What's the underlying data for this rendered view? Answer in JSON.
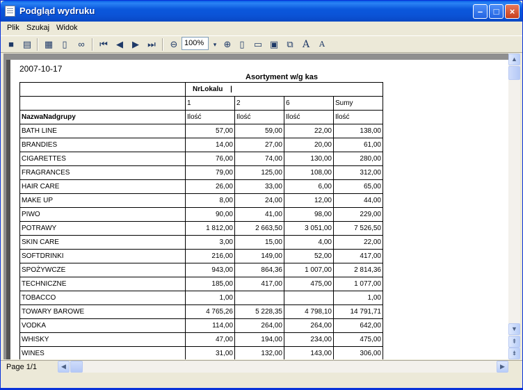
{
  "window": {
    "title": "Podgląd wydruku"
  },
  "menu": [
    "Plik",
    "Szukaj",
    "Widok"
  ],
  "toolbar": {
    "zoom_value": "100%",
    "zoom_arrow": "▾"
  },
  "icons": [
    "save-icon",
    "print-icon",
    "page-setup-icon",
    "page-icon",
    "find-icon",
    "first-page-icon",
    "prev-page-icon",
    "next-page-icon",
    "last-page-icon",
    "zoom-out-icon",
    "zoom-in-icon",
    "single-page-icon",
    "two-pages-icon",
    "multi-pages-icon",
    "copy-icon",
    "font-larger-icon",
    "font-smaller-icon"
  ],
  "report": {
    "date": "2007-10-17",
    "title": "Asortyment w/g kas",
    "group_label": "NrLokalu",
    "group_sep": "|",
    "col_ids": [
      "1",
      "2",
      "6",
      "Sumy"
    ],
    "row_header": "NazwaNadgrupy",
    "measure": [
      "Ilość",
      "Ilość",
      "Ilość",
      "Ilość"
    ],
    "rows": [
      [
        "BATH LINE",
        "57,00",
        "59,00",
        "22,00",
        "138,00"
      ],
      [
        "BRANDIES",
        "14,00",
        "27,00",
        "20,00",
        "61,00"
      ],
      [
        "CIGARETTES",
        "76,00",
        "74,00",
        "130,00",
        "280,00"
      ],
      [
        "FRAGRANCES",
        "79,00",
        "125,00",
        "108,00",
        "312,00"
      ],
      [
        "HAIR CARE",
        "26,00",
        "33,00",
        "6,00",
        "65,00"
      ],
      [
        "MAKE UP",
        "8,00",
        "24,00",
        "12,00",
        "44,00"
      ],
      [
        "PIWO",
        "90,00",
        "41,00",
        "98,00",
        "229,00"
      ],
      [
        "POTRAWY",
        "1 812,00",
        "2 663,50",
        "3 051,00",
        "7 526,50"
      ],
      [
        "SKIN CARE",
        "3,00",
        "15,00",
        "4,00",
        "22,00"
      ],
      [
        "SOFTDRINKI",
        "216,00",
        "149,00",
        "52,00",
        "417,00"
      ],
      [
        "SPOŻYWCZE",
        "943,00",
        "864,36",
        "1 007,00",
        "2 814,36"
      ],
      [
        "TECHNICZNE",
        "185,00",
        "417,00",
        "475,00",
        "1 077,00"
      ],
      [
        "TOBACCO",
        "1,00",
        "",
        "",
        "1,00"
      ],
      [
        "TOWARY BAROWE",
        "4 765,26",
        "5 228,35",
        "4 798,10",
        "14 791,71"
      ],
      [
        "VODKA",
        "114,00",
        "264,00",
        "264,00",
        "642,00"
      ],
      [
        "WHISKY",
        "47,00",
        "194,00",
        "234,00",
        "475,00"
      ],
      [
        "WINES",
        "31,00",
        "132,00",
        "143,00",
        "306,00"
      ]
    ]
  },
  "status": {
    "page": "Page 1/1"
  }
}
